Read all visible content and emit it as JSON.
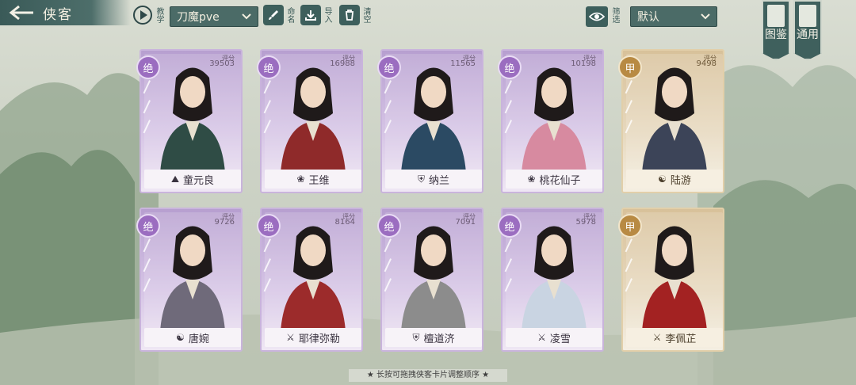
{
  "header": {
    "title": "侠客",
    "teach_label": "教学",
    "rename_label": "命名",
    "import_label": "导入",
    "clear_label": "清空",
    "filter_label": "筛选",
    "preset_value": "刀魔pve",
    "sort_value": "默认",
    "codex_label": "图鉴",
    "general_label": "通用"
  },
  "score_label": "评分",
  "cards": [
    {
      "name": "童元良",
      "rank": "绝",
      "tier": "jue",
      "score": "39503",
      "school": "mountain",
      "color": "#2f4c45"
    },
    {
      "name": "王维",
      "rank": "绝",
      "tier": "jue",
      "score": "16988",
      "school": "lotus",
      "color": "#8f2a2a"
    },
    {
      "name": "纳兰",
      "rank": "绝",
      "tier": "jue",
      "score": "11565",
      "school": "shield",
      "color": "#2b4a63"
    },
    {
      "name": "桃花仙子",
      "rank": "绝",
      "tier": "jue",
      "score": "10198",
      "school": "lotus",
      "color": "#d78aa0"
    },
    {
      "name": "陆游",
      "rank": "甲",
      "tier": "jia",
      "score": "9498",
      "school": "taiji",
      "color": "#3c4458"
    },
    {
      "name": "唐婉",
      "rank": "绝",
      "tier": "jue",
      "score": "9726",
      "school": "taiji",
      "color": "#6f6a7a"
    },
    {
      "name": "耶律弥勒",
      "rank": "绝",
      "tier": "jue",
      "score": "8164",
      "school": "sword",
      "color": "#9c2b2b"
    },
    {
      "name": "檀道济",
      "rank": "绝",
      "tier": "jue",
      "score": "7091",
      "school": "shield",
      "color": "#8c8c8c"
    },
    {
      "name": "凌雪",
      "rank": "绝",
      "tier": "jue",
      "score": "5978",
      "school": "sword",
      "color": "#c9d4e2"
    },
    {
      "name": "李佩芷",
      "rank": "甲",
      "tier": "jia",
      "score": "",
      "school": "sword",
      "color": "#a32222"
    }
  ],
  "hint": "★ 长按可拖拽侠客卡片调整顺序 ★"
}
